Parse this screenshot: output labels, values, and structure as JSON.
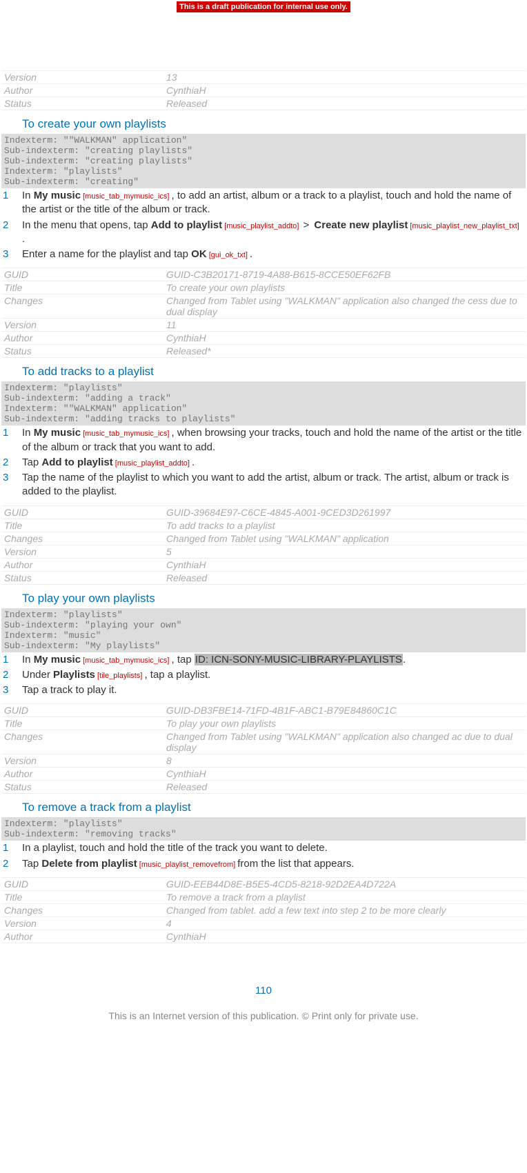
{
  "banner": "This is a draft publication for internal use only.",
  "page_number": "110",
  "footer": "This is an Internet version of this publication. © Print only for private use.",
  "top_meta": {
    "rows": [
      {
        "k": "Version",
        "v": "13"
      },
      {
        "k": "Author",
        "v": "CynthiaH"
      },
      {
        "k": "Status",
        "v": "Released"
      }
    ]
  },
  "sections": {
    "create": {
      "heading": "To create your own playlists",
      "indexterm": "Indexterm: \"\"WALKMAN\" application\"\nSub-indexterm: \"creating playlists\"\nSub-indexterm: \"creating playlists\"\nIndexterm: \"playlists\"\nSub-indexterm: \"creating\"",
      "step1": {
        "pre": "In ",
        "ui1": "My music",
        "key1": " [music_tab_mymusic_ics] ",
        "post": ", to add an artist, album or a track to a playlist, touch and hold the name of the artist or the title of the album or track."
      },
      "step2": {
        "pre": "In the menu that opens, tap ",
        "ui1": "Add to playlist",
        "key1": " [music_playlist_addto] ",
        "gt": ">",
        "ui2": "Create new playlist",
        "key2": " [music_playlist_new_playlist_txt] ",
        "post": "."
      },
      "step3": {
        "pre": "Enter a name for the playlist and tap ",
        "ui1": "OK",
        "key1": " [gui_ok_txt] ",
        "post": "."
      },
      "meta": {
        "rows": [
          {
            "k": "GUID",
            "v": "GUID-C3B20171-8719-4A88-B615-8CCE50EF62FB"
          },
          {
            "k": "Title",
            "v": "To create your own playlists"
          },
          {
            "k": "Changes",
            "v": "Changed from Tablet using \"WALKMAN\" application also changed the cess due to dual display"
          },
          {
            "k": "Version",
            "v": "11"
          },
          {
            "k": "Author",
            "v": "CynthiaH"
          },
          {
            "k": "Status",
            "v": "Released*"
          }
        ]
      }
    },
    "add": {
      "heading": "To add tracks to a playlist",
      "indexterm": "Indexterm: \"playlists\"\nSub-indexterm: \"adding a track\"\nIndexterm: \"\"WALKMAN\" application\"\nSub-indexterm: \"adding tracks to playlists\"",
      "step1": {
        "pre": "In ",
        "ui1": "My music",
        "key1": " [music_tab_mymusic_ics] ",
        "post": ", when browsing your tracks, touch and hold the name of the artist or the title of the album or track that you want to add."
      },
      "step2": {
        "pre": "Tap ",
        "ui1": "Add to playlist",
        "key1": " [music_playlist_addto] ",
        "post": "."
      },
      "step3": "Tap the name of the playlist to which you want to add the artist, album or track. The artist, album or track is added to the playlist.",
      "meta": {
        "rows": [
          {
            "k": "GUID",
            "v": "GUID-39684E97-C6CE-4845-A001-9CED3D261997"
          },
          {
            "k": "Title",
            "v": "To add tracks to a playlist"
          },
          {
            "k": "Changes",
            "v": "Changed from Tablet using \"WALKMAN\" application"
          },
          {
            "k": "Version",
            "v": "5"
          },
          {
            "k": "Author",
            "v": "CynthiaH"
          },
          {
            "k": "Status",
            "v": "Released"
          }
        ]
      }
    },
    "play": {
      "heading": "To play your own playlists",
      "indexterm": "Indexterm: \"playlists\"\nSub-indexterm: \"playing your own\"\nIndexterm: \"music\"\nSub-indexterm: \"My playlists\"",
      "step1": {
        "pre": "In ",
        "ui1": "My music",
        "key1": " [music_tab_mymusic_ics] ",
        "mid": ", tap ",
        "mark": "ID: ICN-SONY-MUSIC-LIBRARY-PLAYLISTS",
        "post": "."
      },
      "step2": {
        "pre": "Under ",
        "ui1": "Playlists",
        "key1": " [tile_playlists] ",
        "post": ", tap a playlist."
      },
      "step3": "Tap a track to play it.",
      "meta": {
        "rows": [
          {
            "k": "GUID",
            "v": "GUID-DB3FBE14-71FD-4B1F-ABC1-B79E84860C1C"
          },
          {
            "k": "Title",
            "v": "To play your own playlists"
          },
          {
            "k": "Changes",
            "v": "Changed from Tablet using \"WALKMAN\" application also changed ac due to dual display"
          },
          {
            "k": "Version",
            "v": "8"
          },
          {
            "k": "Author",
            "v": "CynthiaH"
          },
          {
            "k": "Status",
            "v": "Released"
          }
        ]
      }
    },
    "remove": {
      "heading": "To remove a track from a playlist",
      "indexterm": "Indexterm: \"playlists\"\nSub-indexterm: \"removing tracks\"",
      "step1": "In a playlist, touch and hold the title of the track you want to delete.",
      "step2": {
        "pre": "Tap ",
        "ui1": "Delete from playlist",
        "key1": " [music_playlist_removefrom] ",
        "post": "from the list that appears."
      },
      "meta": {
        "rows": [
          {
            "k": "GUID",
            "v": "GUID-EEB44D8E-B5E5-4CD5-8218-92D2EA4D722A"
          },
          {
            "k": "Title",
            "v": "To remove a track from a playlist"
          },
          {
            "k": "Changes",
            "v": "Changed from tablet. add a few text into step 2 to be more clearly"
          },
          {
            "k": "Version",
            "v": "4"
          },
          {
            "k": "Author",
            "v": "CynthiaH"
          }
        ]
      }
    }
  }
}
